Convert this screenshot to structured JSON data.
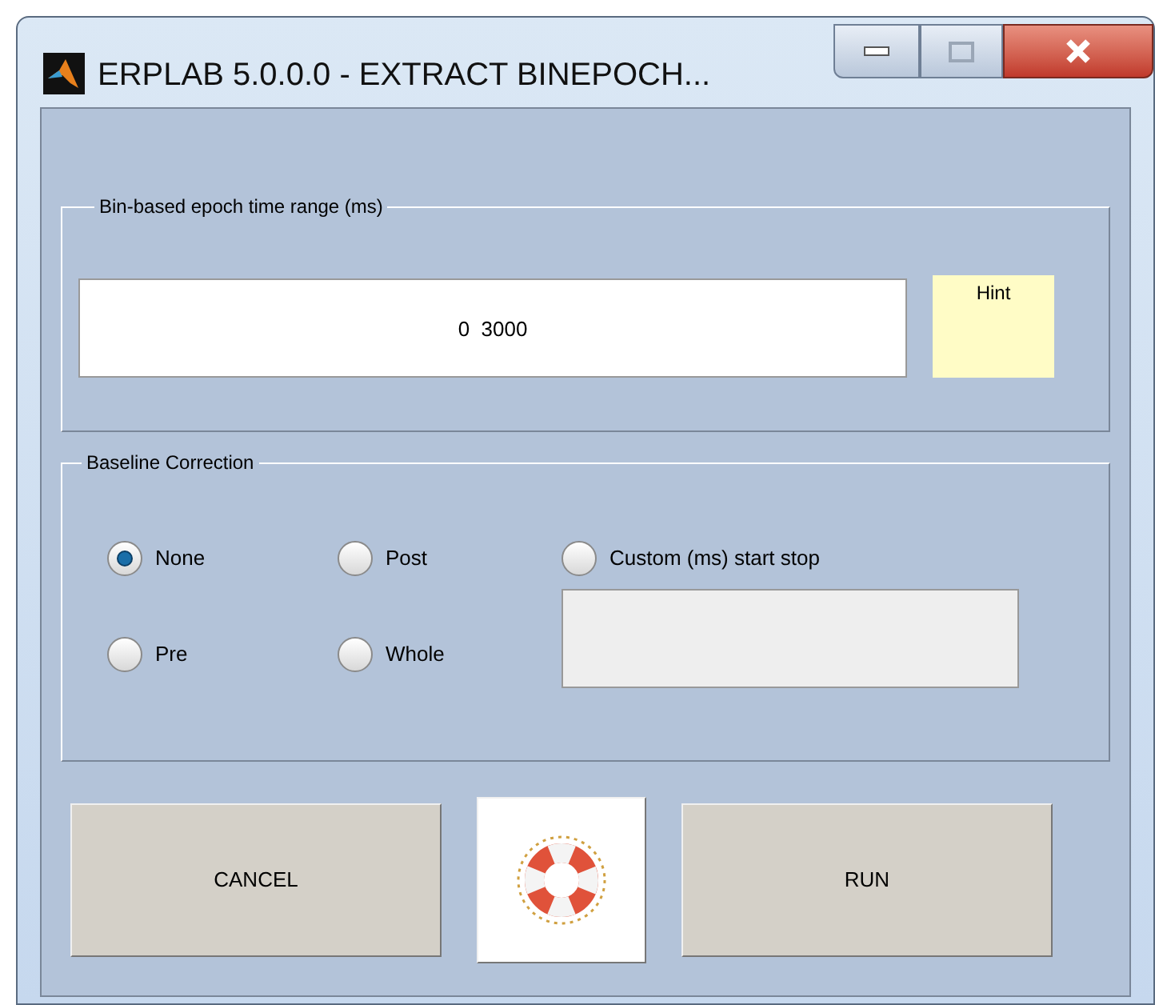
{
  "window": {
    "title": "ERPLAB 5.0.0.0   -   EXTRACT BINEPOCH..."
  },
  "time_range": {
    "legend": "Bin-based epoch time range (ms)",
    "value": "0  3000",
    "hint": "Hint"
  },
  "baseline": {
    "legend": "Baseline Correction",
    "options": [
      {
        "label": "None",
        "selected": true
      },
      {
        "label": "Post",
        "selected": false
      },
      {
        "label": "Custom (ms)  start  stop",
        "selected": false
      },
      {
        "label": "Pre",
        "selected": false
      },
      {
        "label": "Whole",
        "selected": false
      }
    ]
  },
  "buttons": {
    "cancel": "CANCEL",
    "run": "RUN"
  }
}
